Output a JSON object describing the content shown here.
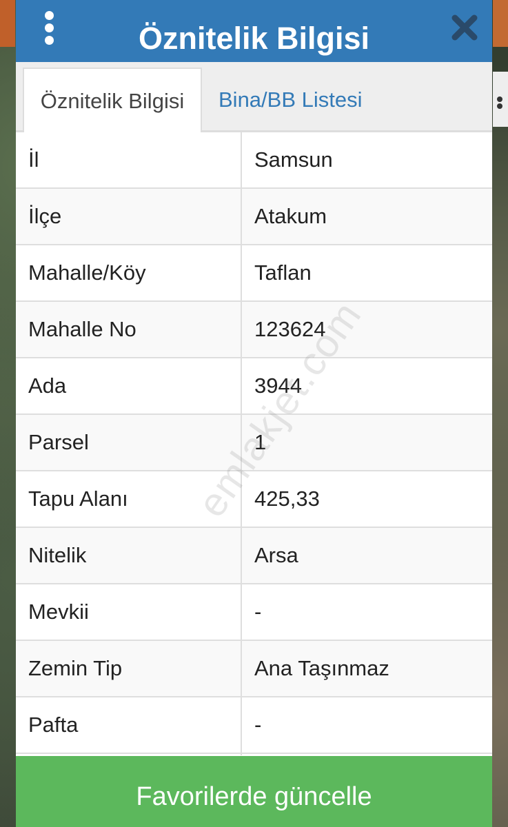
{
  "header": {
    "title": "Öznitelik Bilgisi",
    "menu_icon": "more-vert-icon",
    "close_icon": "close-icon"
  },
  "tabs": [
    {
      "label": "Öznitelik Bilgisi",
      "active": true
    },
    {
      "label": "Bina/BB Listesi",
      "active": false
    }
  ],
  "attributes": [
    {
      "key": "İl",
      "value": "Samsun"
    },
    {
      "key": "İlçe",
      "value": "Atakum"
    },
    {
      "key": "Mahalle/Köy",
      "value": "Taflan"
    },
    {
      "key": "Mahalle No",
      "value": "123624"
    },
    {
      "key": "Ada",
      "value": "3944"
    },
    {
      "key": "Parsel",
      "value": "1"
    },
    {
      "key": "Tapu Alanı",
      "value": "425,33"
    },
    {
      "key": "Nitelik",
      "value": "Arsa"
    },
    {
      "key": "Mevkii",
      "value": "-"
    },
    {
      "key": "Zemin Tip",
      "value": "Ana Taşınmaz"
    },
    {
      "key": "Pafta",
      "value": "-"
    }
  ],
  "watermark": "emlakjet.com",
  "footer": {
    "button_label": "Favorilerde güncelle"
  },
  "colors": {
    "header": "#337ab7",
    "tab_link": "#337ab7",
    "footer_button": "#5cb85c"
  }
}
